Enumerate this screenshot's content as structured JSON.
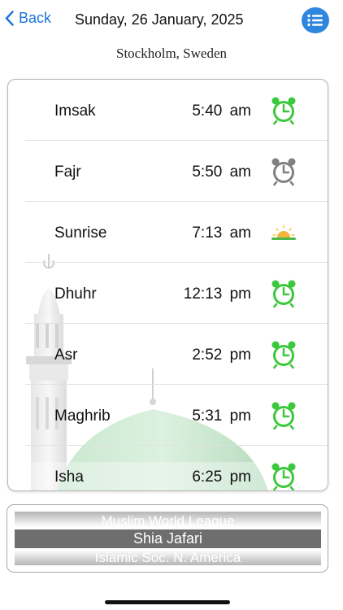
{
  "nav": {
    "back_label": "Back",
    "date": "Sunday, 26 January, 2025",
    "menu_icon": "list-icon",
    "accent": "#1a73d9",
    "menu_bg": "#2e86de"
  },
  "location": "Stockholm, Sweden",
  "prayers": [
    {
      "name": "Imsak",
      "time": "5:40 am",
      "icon": "alarm-clock-icon",
      "alarm": "on"
    },
    {
      "name": "Fajr",
      "time": "5:50 am",
      "icon": "alarm-clock-icon",
      "alarm": "off"
    },
    {
      "name": "Sunrise",
      "time": "7:13 am",
      "icon": "sunrise-icon"
    },
    {
      "name": "Dhuhr",
      "time": "12:13 pm",
      "icon": "alarm-clock-icon",
      "alarm": "on"
    },
    {
      "name": "Asr",
      "time": "2:52 pm",
      "icon": "alarm-clock-icon",
      "alarm": "on"
    },
    {
      "name": "Maghrib",
      "time": "5:31 pm",
      "icon": "alarm-clock-icon",
      "alarm": "on"
    },
    {
      "name": "Isha",
      "time": "6:25 pm",
      "icon": "alarm-clock-icon",
      "alarm": "on"
    }
  ],
  "colors": {
    "alarm_on": "#3cc83c",
    "alarm_off": "#808080"
  },
  "method_picker": {
    "options": [
      "Muslim World League",
      "Shia Jafari",
      "Islamic Soc. N. America"
    ],
    "selected": "Shia Jafari"
  }
}
